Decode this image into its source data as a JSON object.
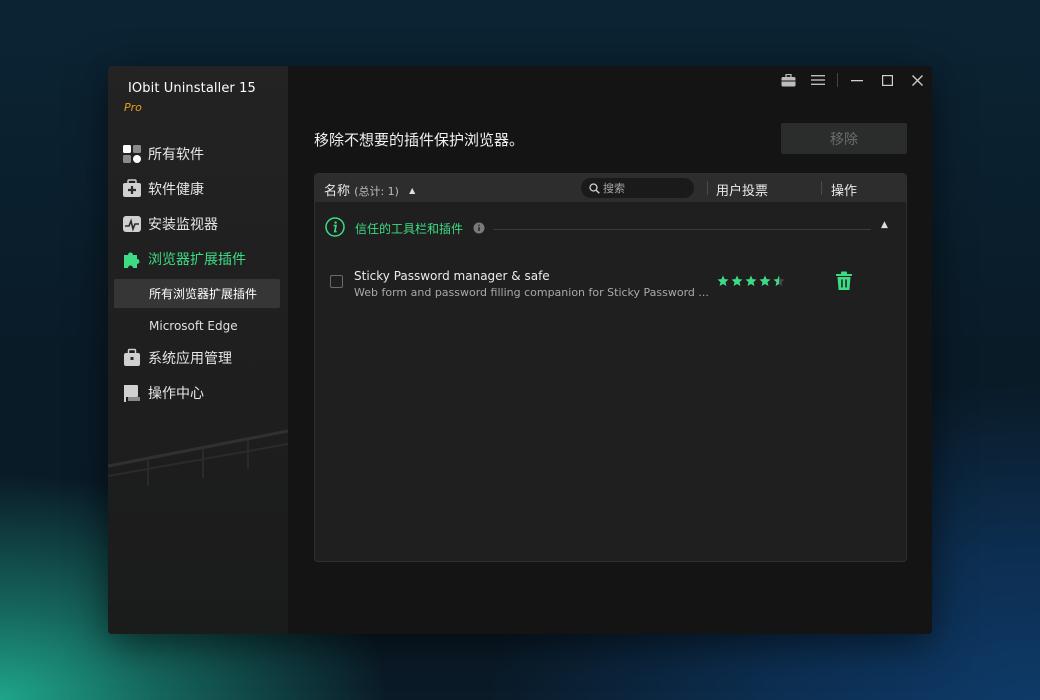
{
  "app": {
    "title": "IObit Uninstaller 15",
    "edition": "Pro"
  },
  "colors": {
    "accent": "#3ddc84",
    "edition": "#e7a21b"
  },
  "sidebar": {
    "items": [
      {
        "label": "所有软件",
        "icon": "grid-apps-icon"
      },
      {
        "label": "软件健康",
        "icon": "health-kit-icon"
      },
      {
        "label": "安装监视器",
        "icon": "monitor-icon"
      },
      {
        "label": "浏览器扩展插件",
        "icon": "puzzle-icon",
        "active": true
      },
      {
        "label": "系统应用管理",
        "icon": "briefcase-icon"
      },
      {
        "label": "操作中心",
        "icon": "flag-icon"
      }
    ],
    "subitems": [
      {
        "label": "所有浏览器扩展插件",
        "active": true
      },
      {
        "label": "Microsoft Edge"
      }
    ]
  },
  "titlebar": {
    "icons": [
      "toolbox-icon",
      "menu-icon",
      "minimize-icon",
      "maximize-icon",
      "close-icon"
    ]
  },
  "main": {
    "heading": "移除不想要的插件保护浏览器。",
    "remove_label": "移除",
    "table": {
      "name_header": "名称",
      "count_text": "(总计: 1)",
      "search_placeholder": "搜索",
      "votes_header": "用户投票",
      "action_header": "操作"
    },
    "group": {
      "label": "信任的工具栏和插件"
    },
    "items": [
      {
        "title": "Sticky Password manager & safe",
        "description": "Web form and password filling companion for Sticky Password ...",
        "rating": 4.5
      }
    ]
  }
}
